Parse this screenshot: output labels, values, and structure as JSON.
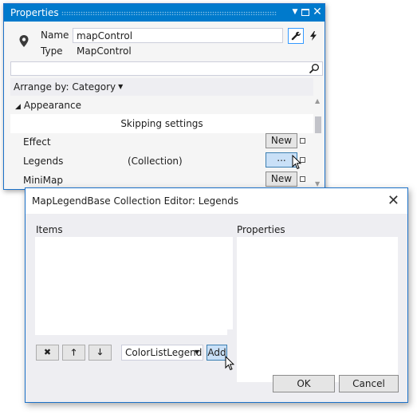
{
  "properties_window": {
    "title": "Properties",
    "title_icons": [
      "dropdown-icon",
      "maximize-icon",
      "close-icon"
    ],
    "close_glyph": "✕",
    "dropdown_glyph": "▼",
    "name_label": "Name",
    "name_value": "mapControl",
    "type_label": "Type",
    "type_value": "MapControl",
    "wrench_glyph": "🔧",
    "bolt_glyph": "⚡",
    "search_value": "",
    "arrange_label": "Arrange by: Category",
    "arrange_caret": "▼",
    "category": {
      "expand_glyph": "◢",
      "label": "Appearance"
    },
    "skipping_text": "Skipping settings",
    "rows": [
      {
        "label": "Effect",
        "value": "",
        "button": "New"
      },
      {
        "label": "Legends",
        "value": "(Collection)",
        "button": "..."
      },
      {
        "label": "MiniMap",
        "value": "",
        "button": "New"
      }
    ],
    "scroll_up_glyph": "▲",
    "scroll_down_glyph": "▼"
  },
  "dialog": {
    "title": "MapLegendBase Collection Editor: Legends",
    "close_glyph": "✕",
    "items_label": "Items",
    "properties_label": "Properties",
    "remove_glyph": "✖",
    "up_glyph": "🡑",
    "down_glyph": "🡓",
    "legend_type": "ColorListLegend",
    "combo_caret": "▼",
    "add_label": "Add",
    "ok_label": "OK",
    "cancel_label": "Cancel"
  },
  "colors": {
    "accent": "#007acc",
    "window_border": "#1c71c8",
    "hot_button": "#c9e0f7"
  }
}
